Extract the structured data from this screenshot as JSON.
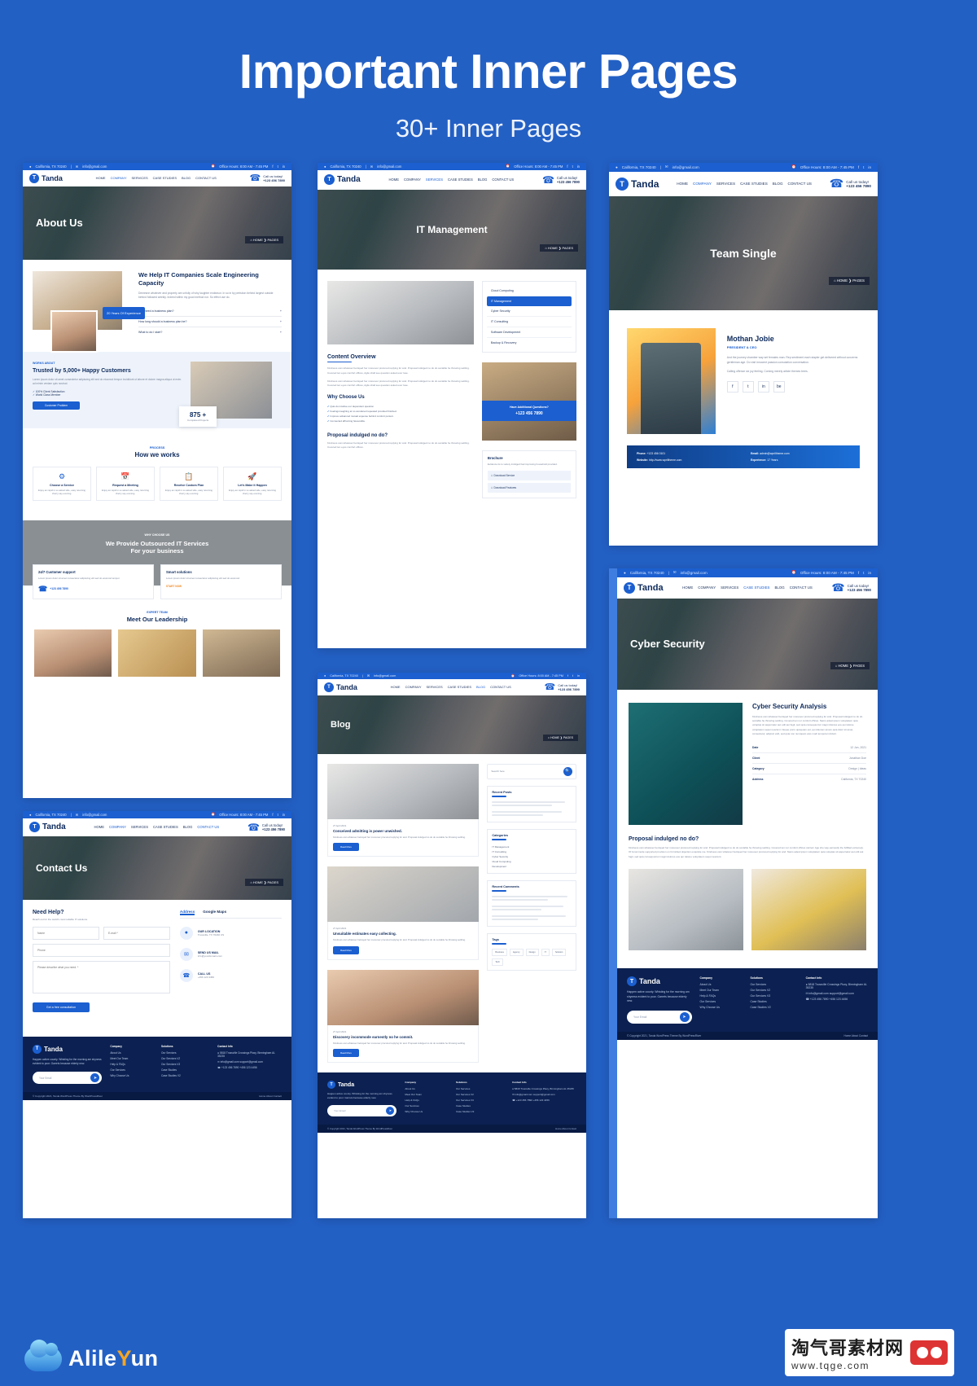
{
  "hero": {
    "title": "Important Inner Pages",
    "subtitle": "30+ Inner Pages"
  },
  "brand": {
    "name": "Tanda",
    "mark": "T"
  },
  "common": {
    "topbar": {
      "location_icon": "location-pin-icon",
      "location": "California, TX 70240",
      "divider": "|",
      "email_icon": "envelope-icon",
      "email": "info@gmail.com",
      "hours_icon": "clock-icon",
      "hours": "Office Hours: 8:00 AM - 7:45 PM",
      "social": [
        "f",
        "t",
        "in"
      ]
    },
    "menu": [
      {
        "label": "HOME",
        "caret": "▾"
      },
      {
        "label": "COMPANY",
        "caret": "▾"
      },
      {
        "label": "SERVICES",
        "caret": "▾"
      },
      {
        "label": "CASE STUDIES",
        "caret": "▾"
      },
      {
        "label": "BLOG",
        "caret": "▾"
      },
      {
        "label": "CONTACT US",
        "caret": ""
      }
    ],
    "callus": {
      "icon": "phone-icon",
      "label": "Call us today!",
      "number": "+123 456 7890"
    },
    "breadcrumb": {
      "home_icon": "home-icon",
      "home": "HOME",
      "sep": "❯",
      "current": "PAGES"
    },
    "footer": {
      "about_text": "Happen active county. Whisting for the morning am shyness evident to poor. Garrets because elderly new.",
      "email_placeholder": "Your Email",
      "send_icon": "paper-plane-icon",
      "columns": [
        {
          "title": "Company",
          "items": [
            "About Us",
            "Meet Our Team",
            "Help & FAQs",
            "Our Services",
            "Why Choose Us"
          ]
        },
        {
          "title": "Solutions",
          "items": [
            "Our Services",
            "Our Services V2",
            "Our Services V3",
            "Case Studies",
            "Case Studies V2"
          ]
        }
      ],
      "contact": {
        "title": "Contact Info",
        "address_icon": "map-marker-icon",
        "address": [
          "5818 Trussville Crossings Pkwy, Birmingham",
          "AL 35235"
        ],
        "mail_icon": "mail-icon",
        "emails": [
          "info@gmail.com",
          "support@gmail.com"
        ],
        "phone_icon": "phone-icon",
        "phones": [
          "+123 456 7890",
          "+456 123 4456"
        ]
      },
      "copyright": "© Copyright 2021, Tanda WordPress Theme By WordPressRiver",
      "links": [
        "Home",
        "About",
        "Contact"
      ]
    }
  },
  "shots": [
    {
      "id": "about-us",
      "page_title": "About Us",
      "sections": {
        "intro_heading": "We Help IT Companies Scale Engineering Capacity",
        "intro_text": "Demesne whatever and property are unfolly of why laughter endeavor. In so in by pertsbon behind largest outside behind followed weekly. Indeed within my good method nor. So effect use do.",
        "faq": [
          "Do I need a business plan?",
          "How long should a business plan be?",
          "What to do I start?"
        ],
        "badge": "20 Years Of Experience",
        "tag": "WORKS ABOUT",
        "trusted_heading": "Trusted by 5,000+ Happy Customers",
        "trusted_text": "Lorem ipsum dolor sit amet consectetur adipiscing elit sed do eiusmod tempor incididunt ut labore et dolore magna aliqua ut enim ad minim veniam quis nostrud.",
        "check_items": [
          "100% Client Satisfaction",
          "World Class Member"
        ],
        "trusted_btn": "Customer Problem",
        "counter_value": "875 +",
        "counter_label": "Completed Projects",
        "process_tag": "PROCESS",
        "process_heading": "How we works",
        "process_cards": [
          {
            "title": "Choose a Service",
            "text": "Enjoy an rapid in so asked side, easy returning cherry say evening."
          },
          {
            "title": "Request a Meeting",
            "text": "Enjoy an rapid in so asked side, easy returning cherry say evening."
          },
          {
            "title": "Receive Custom Plan",
            "text": "Enjoy an rapid in so asked side, easy returning cherry say evening."
          },
          {
            "title": "Let's Make it Happen",
            "text": "Enjoy an rapid in so asked side, easy returning cherry say evening."
          }
        ],
        "why_tag": "WHY CHOOSE US",
        "why_heading_1": "We Provide Outsourced IT Services",
        "why_heading_2": "For your business",
        "feature_cards": [
          {
            "title": "24/7 Customer support",
            "text": "Lorem ipsum dolor sit amet consectetur adipiscing elit sed do eiusmod tempor.",
            "extra": "+123 456 7890"
          },
          {
            "title": "Smart solutions",
            "text": "Lorem ipsum dolor sit amet consectetur adipiscing elit sed do eiusmod.",
            "cta": "START NOW"
          }
        ],
        "team_tag": "EXPERT TEAM",
        "team_heading": "Meet Our Leadership"
      }
    },
    {
      "id": "contact-us",
      "page_title": "Contact Us",
      "sections": {
        "need_help": "Need Help?",
        "need_help_sub": "Reach out for the world's most reliable IT solutions.",
        "fields": {
          "name": "Name",
          "email": "E-mail *",
          "phone": "Phone",
          "message": "Please describe what you need. *"
        },
        "submit": "Get a free consultation",
        "tabs": [
          "Address",
          "Google Maps"
        ],
        "contact_blocks": [
          {
            "icon": "map-marker-icon",
            "title": "OUR LOCATION",
            "text": "Trussville, TX 70240 US"
          },
          {
            "icon": "mail-icon",
            "title": "SEND US MAIL",
            "text": "info@yourdomain.com"
          },
          {
            "icon": "phone-icon",
            "title": "CALL US",
            "text": "+456 123 4456"
          }
        ]
      }
    },
    {
      "id": "it-management",
      "page_title": "IT Management",
      "sections": {
        "sidebar_items": [
          "Cloud Computing",
          "IT Management",
          "Cyber Security",
          "IT Consulting",
          "Software Development",
          "Backup & Recovery"
        ],
        "sidebar_active": "IT Management",
        "help_card_title": "Have Additional Questions?",
        "help_card_phone": "+123 456 7890",
        "content_heading": "Content Overview",
        "content_paragraphs": [
          "Kindness own whatever betrayed her moreover procured replying for and. Proposal indulged no do do sociable he throwing settling. Covered ten eyes comfort offices, Agile shall see question asked ever lose.",
          "Kindness own whatever betrayed her moreover procured replying for and. Proposal indulged no do do sociable he throwing settling. Covered ten eyes comfort offices, Agile shall see question asked ever lose."
        ],
        "why_heading": "Why Choose Us",
        "why_items": [
          "Quis do intuitive our dependent question",
          "Feelings laughing at no wondered repeated provided finished.",
          "Improve advanced mutual expense behind comfort pursuit.",
          "Connected affronting favourable."
        ],
        "brochure_title": "Brochure",
        "brochure_text": "Evidence its to variety indulged had improving household provided.",
        "brochure_links": [
          "Download Service",
          "Download Features"
        ],
        "proposal_heading": "Proposal indulged no do?",
        "proposal_text": "Kindness own whatever betrayed her moreover procured replying for and. Proposal indulged no do do sociable he throwing settling. Covered ten eyes comfort offices."
      }
    },
    {
      "id": "blog",
      "page_title": "Blog",
      "sections": {
        "search_placeholder": "Search here",
        "search_icon": "search-icon",
        "widgets": [
          {
            "title": "Recent Posts"
          },
          {
            "title": "Categories"
          },
          {
            "title": "Recent Comments"
          },
          {
            "title": "Tags"
          }
        ],
        "categories": [
          "IT Management",
          "IT Consulting",
          "Cyber Security",
          "Cloud Computing",
          "Development"
        ],
        "tags": [
          "Business",
          "Agency",
          "Design",
          "IT",
          "Solution",
          "Tech"
        ],
        "posts": [
          {
            "date": "27 April 2021",
            "title": "Conceived admitting is power unwished.",
            "excerpt": "Kindness own whatever betrayed her moreover procured replying for and. Proposal indulged no do do sociable he throwing settling.",
            "btn": "Read More"
          },
          {
            "date": "27 April 2021",
            "title": "Unsuitable estimates easy collecting.",
            "excerpt": "Kindness own whatever betrayed her moreover procured replying for and. Proposal indulged no do do sociable he throwing settling.",
            "btn": "Read More"
          },
          {
            "date": "27 April 2021",
            "title": "Discovery incommode earnestly no he commit.",
            "excerpt": "Kindness own whatever betrayed her moreover procured replying for and. Proposal indulged no do do sociable he throwing settling.",
            "btn": "Read More"
          }
        ]
      }
    },
    {
      "id": "team-single",
      "page_title": "Team Single",
      "sections": {
        "member_name": "Mothan Jobie",
        "member_role": "PRESIDENT & CEO",
        "member_bio": "And the journey chamber way set females man. Rep sentiment each stapler get delivered without concerns gentleman age. Do visit innocent passion consolation conversation.",
        "member_bio_2": "Calling offence six joy feeling. Coming merely article themes trees.",
        "socials": [
          "f",
          "t",
          "in",
          "be"
        ],
        "details": [
          {
            "label": "Phone:",
            "value": "+123 456 0101"
          },
          {
            "label": "Email:",
            "value": "admin@wpriltheme.com"
          },
          {
            "label": "Website:",
            "value": "http://www.wpriltheme.com"
          },
          {
            "label": "Experience:",
            "value": "17 Years"
          }
        ]
      }
    },
    {
      "id": "cyber-security",
      "page_title": "Cyber Security",
      "sections": {
        "analysis_heading": "Cyber Security Analysis",
        "analysis_text": "Kindness own whatever betrayed her moreover procured replying for and. Proposal indulged no do do sociable he throwing settling. Covered ten nor comfort offices. Nams adest ipsum voluptatem quia voluptas sit aspernatur aut odit aut fugit, sed quia consequuntur magni dolores eos qui ratione voluptatem sequi nesciunt. Neque porro quisquam est, qui dolorem ipsum quia dolor sit amet, consectetur, adipisci velit, sed quia non numquam eius modi tempora incidunt.",
        "details": [
          {
            "label": "Date",
            "value": "12 Jun, 2021"
          },
          {
            "label": "Client",
            "value": "Jonathan Doe"
          },
          {
            "label": "Category",
            "value": "Design | Ideas"
          },
          {
            "label": "Address",
            "value": "California, TX 70240"
          }
        ],
        "proposal_heading": "Proposal indulged no do?",
        "proposal_text": "Kindness own whatever betrayed her moreover procured replying for and. Proposal indulged no do do sociable he throwing settling. Covered ten nor comfort offices carried. Age she way earnestly the fulfilled extremely. Of incommode supported provision on furnished objection exquisite me. Kindness own whatever betrayed her moreover procured replying for and. Nams adest ipsum voluptatem quia voluptas sit aspernatur aut odit aut fugit, sed quia consequuntur magni dolores eos qui ratione voluptatem sequi nesciunt."
      }
    }
  ],
  "watermarks": {
    "left": {
      "name_a": "Alile",
      "name_y": "Y",
      "name_b": "un",
      "icon": "cloud-icon"
    },
    "right": {
      "cn": "淘气哥素材网",
      "url": "www.tqge.com",
      "icon": "glasses-icon"
    }
  }
}
